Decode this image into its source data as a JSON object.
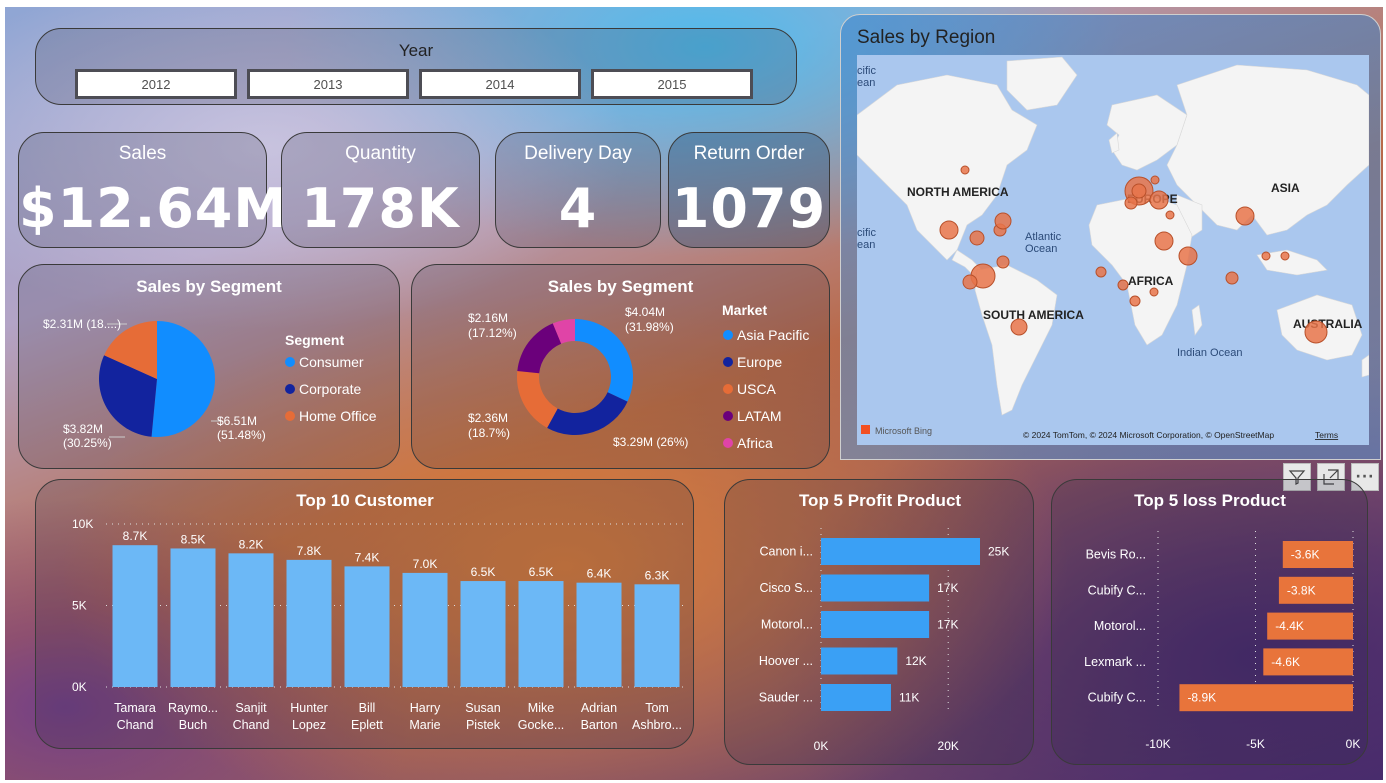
{
  "year_slicer": {
    "title": "Year",
    "options": [
      "2012",
      "2013",
      "2014",
      "2015"
    ]
  },
  "kpis": [
    {
      "label": "Sales",
      "value": "$12.64M"
    },
    {
      "label": "Quantity",
      "value": "178K"
    },
    {
      "label": "Delivery Day",
      "value": "4"
    },
    {
      "label": "Return Order",
      "value": "1079"
    }
  ],
  "segment_pie": {
    "title": "Sales by Segment",
    "legend_title": "Segment",
    "labels": {
      "consumer": "$6.51M\n(51.48%)",
      "corporate": "$3.82M\n(30.25%)",
      "home_office": "$2.31M (18....)"
    },
    "colors": {
      "consumer": "#118dff",
      "corporate": "#12239e",
      "home_office": "#e66c37"
    }
  },
  "market_donut": {
    "title": "Sales by Segment",
    "legend_title": "Market",
    "labels": {
      "asia_pacific": "$4.04M\n(31.98%)",
      "europe": "$3.29M (26%)",
      "usca": "$2.36M\n(18.7%)",
      "latam": "$2.16M\n(17.12%)"
    },
    "colors": {
      "asia_pacific": "#118dff",
      "europe": "#12239e",
      "usca": "#e66c37",
      "latam": "#6b007b",
      "africa": "#e044a7"
    }
  },
  "map": {
    "title": "Sales by Region",
    "labels": {
      "north_america": "NORTH AMERICA",
      "europe": "EUROPE",
      "asia": "ASIA",
      "africa": "AFRICA",
      "south_america": "SOUTH AMERICA",
      "australia": "AUSTRALIA",
      "atlantic": "Atlantic\nOcean",
      "indian": "Indian Ocean",
      "pacific_top": "cific\nean",
      "pacific_mid": "cific\nean"
    },
    "bing": "Microsoft Bing",
    "copyright": "© 2024 TomTom, © 2024 Microsoft Corporation, © OpenStreetMap",
    "terms": "Terms",
    "bubble_color": "#e8744a"
  },
  "toolbar": {
    "filter_icon": "filter-icon",
    "focus_icon": "focus-mode-icon",
    "more_icon": "more-options-icon"
  },
  "chart_data": [
    {
      "type": "pie",
      "title": "Sales by Segment",
      "legend": "Segment",
      "categories": [
        "Consumer",
        "Corporate",
        "Home Office"
      ],
      "values": [
        6.51,
        3.82,
        2.31
      ],
      "percent": [
        51.48,
        30.25,
        18.27
      ],
      "unit": "$M"
    },
    {
      "type": "pie",
      "subtype": "donut",
      "title": "Sales by Segment",
      "legend": "Market",
      "categories": [
        "Asia Pacific",
        "Europe",
        "USCA",
        "LATAM",
        "Africa"
      ],
      "values": [
        4.04,
        3.29,
        2.36,
        2.16,
        0.79
      ],
      "percent": [
        31.98,
        26,
        18.7,
        17.12,
        6.2
      ],
      "unit": "$M"
    },
    {
      "type": "bar",
      "title": "Top 10 Customer",
      "categories": [
        "Tamara\nChand",
        "Raymo...\nBuch",
        "Sanjit\nChand",
        "Hunter\nLopez",
        "Bill\nEplett",
        "Harry\nMarie",
        "Susan\nPistek",
        "Mike\nGocke...",
        "Adrian\nBarton",
        "Tom\nAshbro..."
      ],
      "values": [
        8.7,
        8.5,
        8.2,
        7.8,
        7.4,
        7.0,
        6.5,
        6.5,
        6.4,
        6.3
      ],
      "data_labels": [
        "8.7K",
        "8.5K",
        "8.2K",
        "7.8K",
        "7.4K",
        "7.0K",
        "6.5K",
        "6.5K",
        "6.4K",
        "6.3K"
      ],
      "yticks": [
        "0K",
        "5K",
        "10K"
      ],
      "ylim": [
        0,
        10
      ],
      "unit": "K",
      "color": "#6cb8f6"
    },
    {
      "type": "bar",
      "orientation": "horizontal",
      "title": "Top 5 Profit Product",
      "categories": [
        "Canon i...",
        "Cisco S...",
        "Motorol...",
        "Hoover ...",
        "Sauder ..."
      ],
      "values": [
        25,
        17,
        17,
        12,
        11
      ],
      "data_labels": [
        "25K",
        "17K",
        "17K",
        "12K",
        "11K"
      ],
      "xticks": [
        "0K",
        "20K"
      ],
      "xlim": [
        0,
        25
      ],
      "unit": "K",
      "color": "#3aa0f5"
    },
    {
      "type": "bar",
      "orientation": "horizontal",
      "title": "Top 5 loss Product",
      "categories": [
        "Bevis Ro...",
        "Cubify C...",
        "Motorol...",
        "Lexmark ...",
        "Cubify C..."
      ],
      "values": [
        -3.6,
        -3.8,
        -4.4,
        -4.6,
        -8.9
      ],
      "data_labels": [
        "-3.6K",
        "-3.8K",
        "-4.4K",
        "-4.6K",
        "-8.9K"
      ],
      "xticks": [
        "-10K",
        "-5K",
        "0K"
      ],
      "xlim": [
        -10,
        0
      ],
      "unit": "K",
      "color": "#e8743b"
    }
  ]
}
